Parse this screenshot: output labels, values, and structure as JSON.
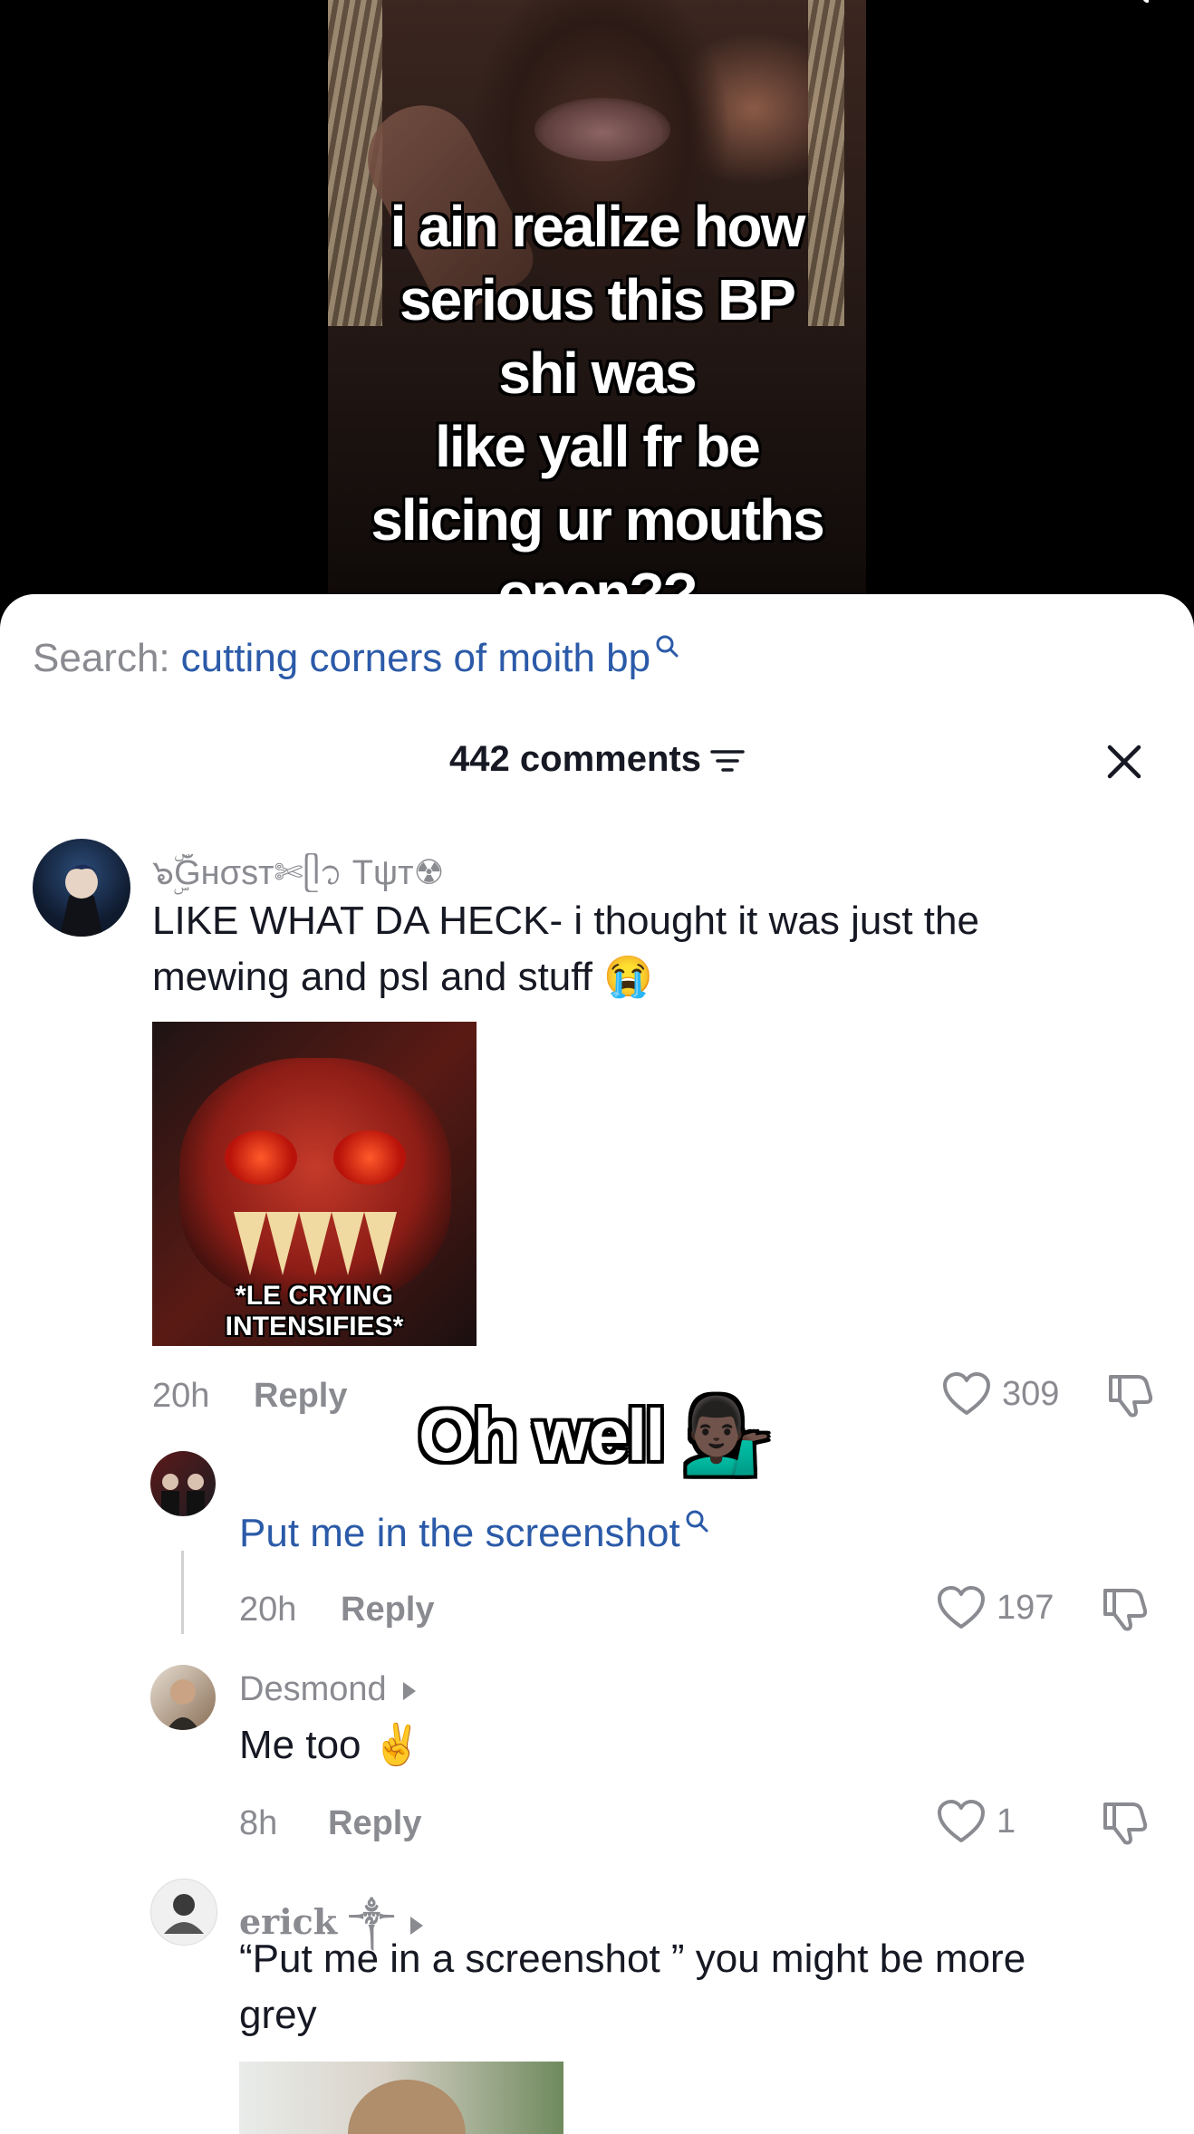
{
  "video": {
    "caption_lines": [
      "i ain realize how",
      "serious this BP",
      "shi was",
      "like yall fr be",
      "slicing ur mouths",
      "open??"
    ]
  },
  "search": {
    "label": "Search:",
    "term": "cutting corners of moith bp"
  },
  "header": {
    "comment_count": "442 comments"
  },
  "comments": [
    {
      "username": "๖ۣۜĞнσѕт✄ᥫ᭡ Tψт☢",
      "text_line1": "LIKE WHAT DA HECK- i thought it was just the",
      "text_line2": "mewing and psl and stuff 😭",
      "meme_caption_line1": "*LE CRYING",
      "meme_caption_line2": "INTENSIFIES*",
      "time": "20h",
      "reply_label": "Reply",
      "likes": "309"
    },
    {
      "text": "Put me in the screenshot",
      "time": "20h",
      "reply_label": "Reply",
      "likes": "197"
    },
    {
      "username": "Desmond",
      "text": "Me too ✌️",
      "time": "8h",
      "reply_label": "Reply",
      "likes": "1"
    },
    {
      "username": "erick ༒",
      "text_line1": "“Put me in a screenshot ” you might be more",
      "text_line2": "grey"
    }
  ],
  "overlay_sticker": "Oh well 💁🏿‍♂️",
  "colors": {
    "link_blue": "#2b5aa8",
    "muted_gray": "#8a8b91",
    "text_dark": "#161823"
  }
}
